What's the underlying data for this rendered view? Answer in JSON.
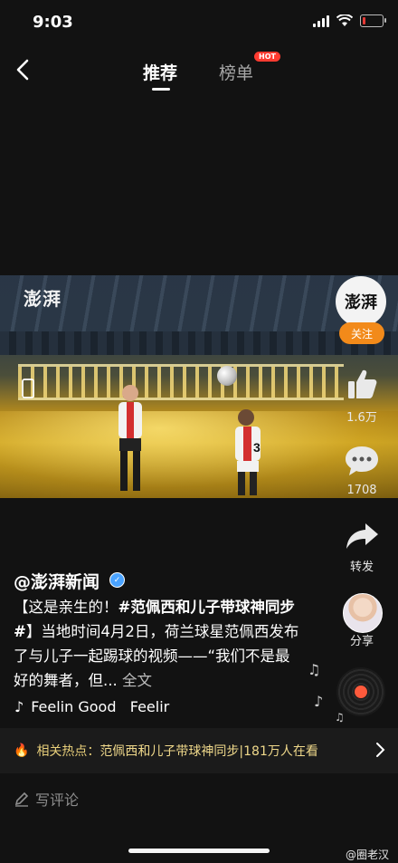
{
  "status_bar": {
    "time": "9:03"
  },
  "nav": {
    "tabs": [
      "推荐",
      "榜单"
    ],
    "hot_badge": "HOT"
  },
  "video": {
    "logo_text": "澎湃"
  },
  "side": {
    "avatar_text": "澎湃",
    "follow_label": "关注",
    "like_count": "1.6万",
    "comment_count": "1708",
    "share_label": "转发",
    "share_label_2": "分享"
  },
  "post": {
    "author": "@澎湃新闻",
    "caption_prefix": "【这是亲生的！",
    "caption_hashtag": "#范佩西和儿子带球神同步#",
    "caption_body": "】当地时间4月2日，荷兰球星范佩西发布了与儿子一起踢球的视频——“我们不是最好的舞者，但...",
    "caption_more": " 全文",
    "music": "Feelin Good   Feelir"
  },
  "trending": {
    "prefix": "相关热点：",
    "text": "范佩西和儿子带球神同步|181万人在看"
  },
  "comment": {
    "placeholder": "写评论"
  },
  "watermark": "@圈老汉"
}
